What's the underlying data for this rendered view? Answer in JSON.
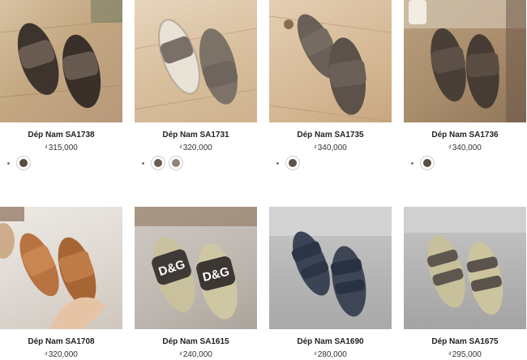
{
  "products": [
    {
      "title": "Dép Nam SA1738",
      "price": "315,000",
      "currency": "₫",
      "swatch_colors": [
        "#5a4a3e"
      ]
    },
    {
      "title": "Dép Nam SA1731",
      "price": "320,000",
      "currency": "₫",
      "swatch_colors": [
        "#6c5c50",
        "#8f8478"
      ]
    },
    {
      "title": "Dép Nam SA1735",
      "price": "340,000",
      "currency": "₫",
      "swatch_colors": [
        "#5f5248"
      ]
    },
    {
      "title": "Dép Nam SA1736",
      "price": "340,000",
      "currency": "₫",
      "swatch_colors": [
        "#5b4c40"
      ]
    },
    {
      "title": "Dép Nam SA1708",
      "price": "320,000",
      "currency": "₫",
      "swatch_colors": []
    },
    {
      "title": "Dép Nam SA1615",
      "price": "240,000",
      "currency": "₫",
      "swatch_colors": []
    },
    {
      "title": "Dép Nam SA1690",
      "price": "280,000",
      "currency": "₫",
      "swatch_colors": []
    },
    {
      "title": "Dép Nam SA1675",
      "price": "295,000",
      "currency": "₫",
      "swatch_colors": []
    }
  ],
  "brand_print": "D&G"
}
